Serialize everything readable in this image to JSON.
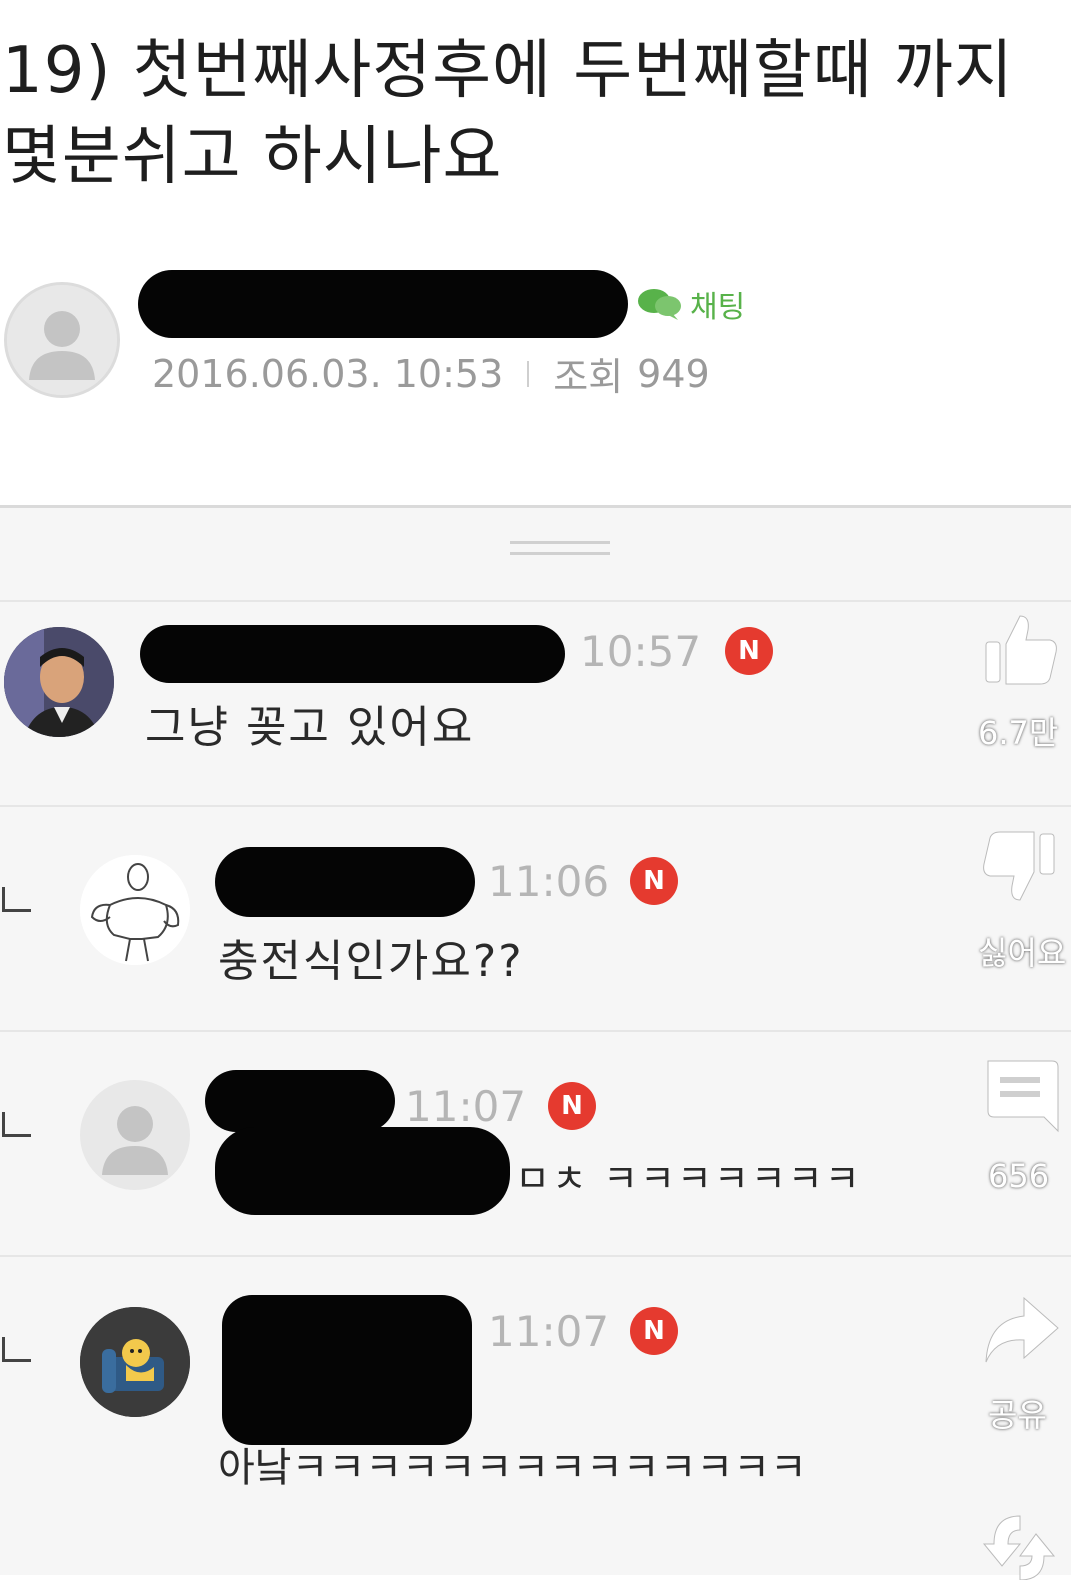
{
  "post": {
    "title": "19) 첫번째사정후에 두번째할때 까지 몇분쉬고 하시나요",
    "chat_label": "채팅",
    "date": "2016.06.03. 10:53",
    "views_label": "조회",
    "views": "949"
  },
  "comments": [
    {
      "time": "10:57",
      "badge": "N",
      "text": "그냥 꽂고 있어요",
      "avatar": "man-photo"
    },
    {
      "time": "11:06",
      "badge": "N",
      "text": "충전식인가요??",
      "avatar": "muscle-drawing"
    },
    {
      "time": "11:07",
      "badge": "N",
      "text": "ㅁㅊ ㅋㅋㅋㅋㅋㅋㅋ",
      "avatar": "default-profile"
    },
    {
      "time": "11:07",
      "badge": "N",
      "text": "아낰ㅋㅋㅋㅋㅋㅋㅋㅋㅋㅋㅋㅋㅋㅋ",
      "avatar": "character-on-sofa"
    }
  ],
  "actions": {
    "like_count": "6.7만",
    "dislike_label": "싫어요",
    "comment_count": "656",
    "share_label": "공유"
  },
  "colors": {
    "badge": "#e53a2f",
    "chat": "#58b24a",
    "meta": "#9a9a9a"
  }
}
